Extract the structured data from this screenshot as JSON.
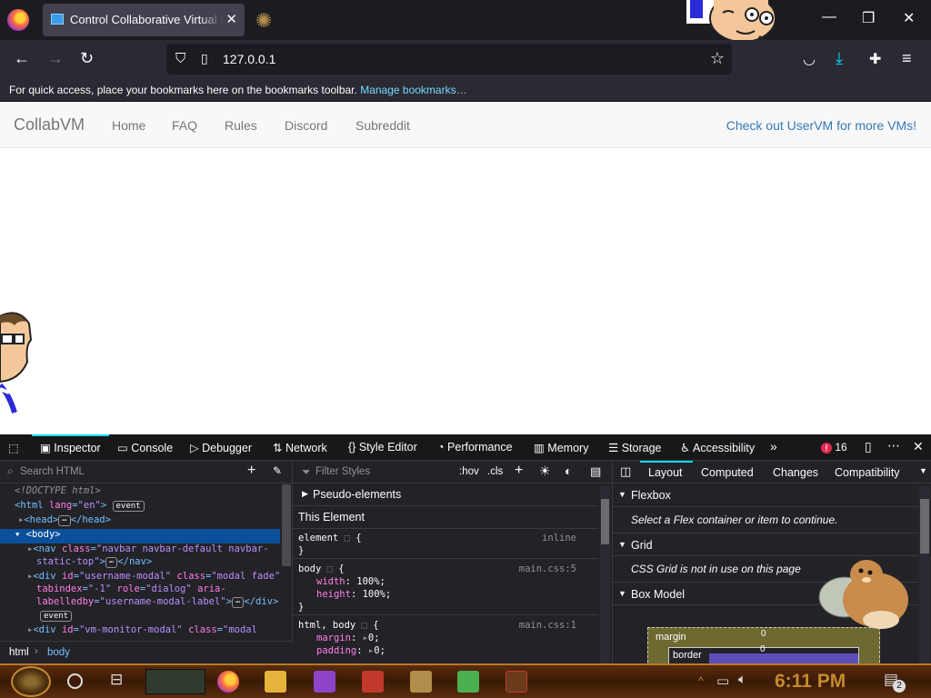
{
  "browser": {
    "tab_title": "Control Collaborative Virtual Machines!",
    "tab_close": "✕",
    "url": "127.0.0.1",
    "bookmarks_message": "For quick access, place your bookmarks here on the bookmarks toolbar.",
    "bookmarks_link": "Manage bookmarks…"
  },
  "site": {
    "brand": "CollabVM",
    "nav_items": [
      "Home",
      "FAQ",
      "Rules",
      "Discord",
      "Subreddit"
    ],
    "right_link": "Check out UserVM for more VMs!"
  },
  "devtools": {
    "tabs": [
      "Inspector",
      "Console",
      "Debugger",
      "Network",
      "Style Editor",
      "Performance",
      "Memory",
      "Storage",
      "Accessibility"
    ],
    "error_count": "16",
    "search_placeholder": "Search HTML",
    "filter_placeholder": "Filter Styles",
    "hov": ":hov",
    "cls": ".cls",
    "html_lines": {
      "doctype": "<!DOCTYPE html>",
      "html_open": "<html lang=\"en\">",
      "event": "event",
      "head": "<head>",
      "head_close": "</head>",
      "body": "<body>",
      "nav_line1": "<nav class=\"navbar navbar-default navbar-",
      "nav_line2": "static-top\">",
      "nav_close": "</nav>",
      "div1_line1": "<div id=\"username-modal\" class=\"modal fade\"",
      "div1_line2": "tabindex=\"-1\" role=\"dialog\" aria-",
      "div1_line3": "labelledby=\"username-modal-label\">",
      "div_close": "</div>",
      "div2_line1": "<div id=\"vm-monitor-modal\" class=\"modal"
    },
    "breadcrumbs": [
      "html",
      "body"
    ],
    "rules": {
      "pseudo": "Pseudo-elements",
      "this_element": "This Element",
      "element_sel": "element",
      "element_src": "inline",
      "body_sel": "body",
      "body_src": "main.css:5",
      "width_prop": "width",
      "width_val": "100%;",
      "height_prop": "height",
      "height_val": "100%;",
      "htmlbody_sel": "html, body",
      "htmlbody_src": "main.css:1",
      "margin_prop": "margin",
      "margin_val": "0;",
      "padding_prop": "padding",
      "padding_val": "0;"
    },
    "layout_tabs": [
      "Layout",
      "Computed",
      "Changes",
      "Compatibility"
    ],
    "flexbox_title": "Flexbox",
    "flexbox_msg": "Select a Flex container or item to continue.",
    "grid_title": "Grid",
    "grid_msg": "CSS Grid is not in use on this page",
    "boxmodel_title": "Box Model",
    "box_margin": "margin",
    "box_margin_val": "0",
    "box_border": "border",
    "box_border_val": "0"
  },
  "taskbar": {
    "time": "6:11 PM",
    "notif_count": "2"
  }
}
